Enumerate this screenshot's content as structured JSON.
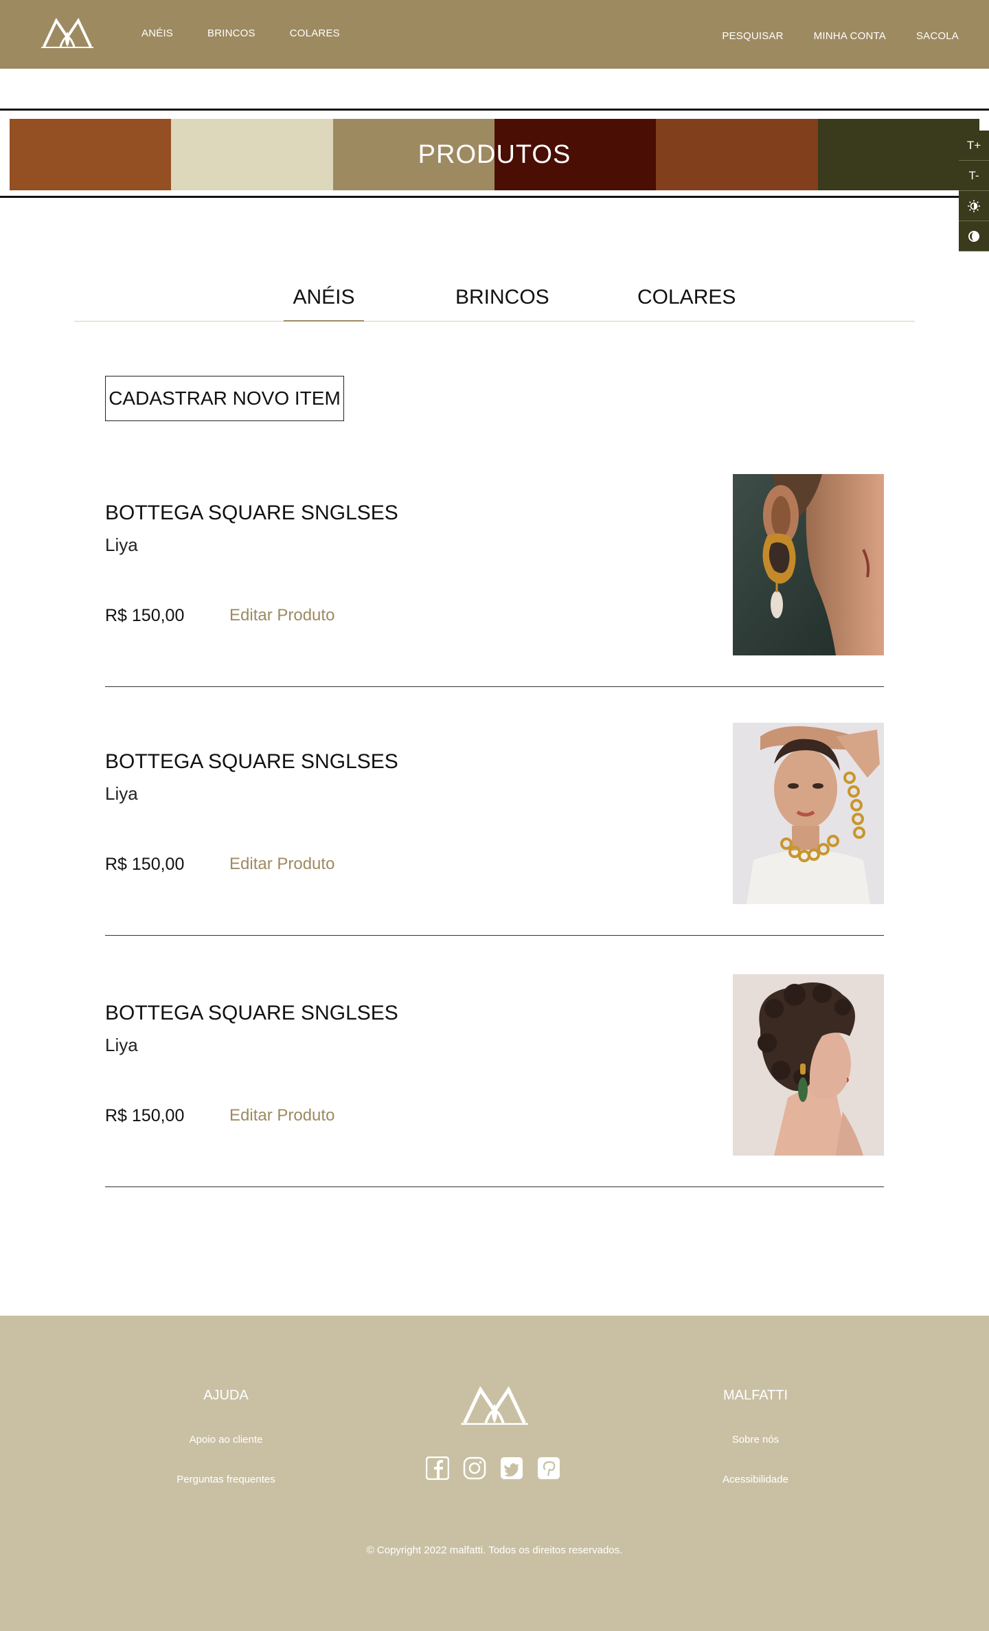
{
  "header": {
    "logo_label": "Malfatti",
    "nav_left": [
      "ANÉIS",
      "BRINCOS",
      "COLARES"
    ],
    "nav_right": [
      "PESQUISAR",
      "MINHA CONTA",
      "SACOLA"
    ]
  },
  "banner": {
    "title": "PRODUTOS",
    "swatches": [
      "#944f22",
      "#ddd7bb",
      "#9e8a61",
      "#4a0e04",
      "#823f1c",
      "#3a3a1c"
    ]
  },
  "accessibility": {
    "increase_text": "T+",
    "decrease_text": "T-",
    "brightness_icon": "brightness-icon",
    "contrast_icon": "contrast-icon"
  },
  "tabs": {
    "items": [
      "ANÉIS",
      "BRINCOS",
      "COLARES"
    ],
    "active": "ANÉIS"
  },
  "new_item_button": "CADASTRAR NOVO ITEM",
  "products": [
    {
      "name": "BOTTEGA SQUARE SNGLSES",
      "brand": "Liya",
      "price": "R$ 150,00",
      "edit_label": "Editar Produto",
      "image": "earring-ear-closeup-photo"
    },
    {
      "name": "BOTTEGA SQUARE SNGLSES",
      "brand": "Liya",
      "price": "R$ 150,00",
      "edit_label": "Editar Produto",
      "image": "chain-necklace-model-photo"
    },
    {
      "name": "BOTTEGA SQUARE SNGLSES",
      "brand": "Liya",
      "price": "R$ 150,00",
      "edit_label": "Editar Produto",
      "image": "curly-hair-earring-photo"
    }
  ],
  "footer": {
    "help_heading": "AJUDA",
    "help_links": [
      "Apoio ao cliente",
      "Perguntas frequentes"
    ],
    "brand_heading": "MALFATTI",
    "brand_links": [
      "Sobre nós",
      "Acessibilidade"
    ],
    "social": [
      "facebook-icon",
      "instagram-icon",
      "twitter-icon",
      "pinterest-icon"
    ],
    "copyright": "© Copyright 2022 malfatti. Todos os direitos reservados."
  },
  "colors": {
    "brand": "#9e8a61",
    "footer_bg": "#c9c0a4",
    "dark_olive": "#3a3a1c"
  }
}
